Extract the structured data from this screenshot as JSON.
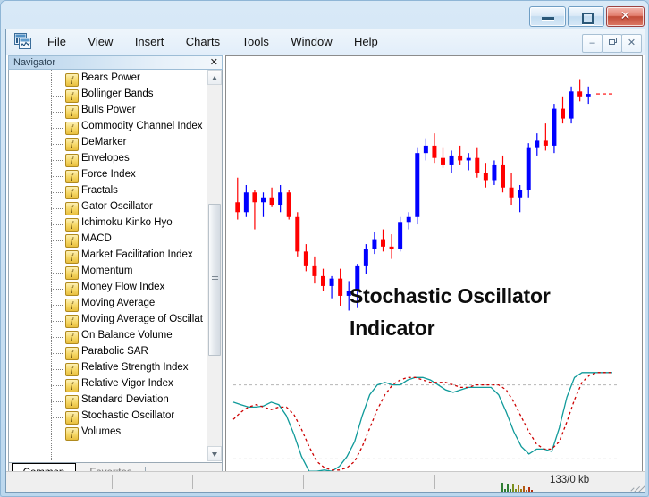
{
  "window": {
    "title": "",
    "controls": {
      "minimize": "minimize",
      "maximize": "maximize",
      "close": "✕"
    }
  },
  "menubar": {
    "app_icon": "charts-icon",
    "items": [
      {
        "label": "File"
      },
      {
        "label": "View"
      },
      {
        "label": "Insert"
      },
      {
        "label": "Charts"
      },
      {
        "label": "Tools"
      },
      {
        "label": "Window"
      },
      {
        "label": "Help"
      }
    ],
    "mdi_controls": {
      "minimize": "–",
      "restore": "❐",
      "close": "✕"
    }
  },
  "navigator": {
    "title": "Navigator",
    "close_label": "✕",
    "icon_glyph": "f",
    "items": [
      {
        "label": "Bears Power"
      },
      {
        "label": "Bollinger Bands"
      },
      {
        "label": "Bulls Power"
      },
      {
        "label": "Commodity Channel Index"
      },
      {
        "label": "DeMarker"
      },
      {
        "label": "Envelopes"
      },
      {
        "label": "Force Index"
      },
      {
        "label": "Fractals"
      },
      {
        "label": "Gator Oscillator"
      },
      {
        "label": "Ichimoku Kinko Hyo"
      },
      {
        "label": "MACD"
      },
      {
        "label": "Market Facilitation Index"
      },
      {
        "label": "Momentum"
      },
      {
        "label": "Money Flow Index"
      },
      {
        "label": "Moving Average"
      },
      {
        "label": "Moving Average of Oscillat"
      },
      {
        "label": "On Balance Volume"
      },
      {
        "label": "Parabolic SAR"
      },
      {
        "label": "Relative Strength Index"
      },
      {
        "label": "Relative Vigor Index"
      },
      {
        "label": "Standard Deviation"
      },
      {
        "label": "Stochastic Oscillator"
      },
      {
        "label": "Volumes"
      }
    ],
    "tabs": [
      {
        "label": "Common",
        "active": true
      },
      {
        "label": "Favorites",
        "active": false
      }
    ]
  },
  "chart": {
    "caption_line1": "Stochastic Oscillator",
    "caption_line2": "Indicator",
    "colors": {
      "bull": "#0000ff",
      "bear": "#ff0000",
      "k_line": "#109a9a",
      "d_line": "#cc0000",
      "level_line": "#b5b5b5"
    }
  },
  "statusbar": {
    "panes": [
      "",
      "",
      "",
      ""
    ],
    "traffic": "133/0 kb",
    "signal_icon": "signal-bars-icon"
  },
  "chart_data": {
    "type": "line",
    "title": "Stochastic Oscillator Indicator",
    "xlabel": "",
    "ylabel": "",
    "panes": [
      {
        "name": "price",
        "type": "candlestick",
        "ylim": [
          0,
          100
        ],
        "candles": [
          {
            "o": 56,
            "h": 66,
            "l": 49,
            "c": 52
          },
          {
            "o": 52,
            "h": 63,
            "l": 50,
            "c": 60
          },
          {
            "o": 60,
            "h": 61,
            "l": 45,
            "c": 56
          },
          {
            "o": 56,
            "h": 60,
            "l": 50,
            "c": 58
          },
          {
            "o": 58,
            "h": 62,
            "l": 54,
            "c": 55
          },
          {
            "o": 55,
            "h": 63,
            "l": 52,
            "c": 60
          },
          {
            "o": 60,
            "h": 61,
            "l": 49,
            "c": 50
          },
          {
            "o": 50,
            "h": 52,
            "l": 34,
            "c": 36
          },
          {
            "o": 36,
            "h": 39,
            "l": 28,
            "c": 30
          },
          {
            "o": 30,
            "h": 34,
            "l": 23,
            "c": 26
          },
          {
            "o": 26,
            "h": 29,
            "l": 20,
            "c": 22
          },
          {
            "o": 22,
            "h": 26,
            "l": 17,
            "c": 25
          },
          {
            "o": 25,
            "h": 29,
            "l": 14,
            "c": 18
          },
          {
            "o": 18,
            "h": 24,
            "l": 12,
            "c": 20
          },
          {
            "o": 20,
            "h": 31,
            "l": 13,
            "c": 30
          },
          {
            "o": 30,
            "h": 39,
            "l": 27,
            "c": 37
          },
          {
            "o": 37,
            "h": 44,
            "l": 35,
            "c": 41
          },
          {
            "o": 41,
            "h": 45,
            "l": 36,
            "c": 38
          },
          {
            "o": 38,
            "h": 43,
            "l": 33,
            "c": 37
          },
          {
            "o": 37,
            "h": 50,
            "l": 36,
            "c": 48
          },
          {
            "o": 48,
            "h": 52,
            "l": 45,
            "c": 50
          },
          {
            "o": 50,
            "h": 78,
            "l": 47,
            "c": 76
          },
          {
            "o": 76,
            "h": 82,
            "l": 73,
            "c": 79
          },
          {
            "o": 79,
            "h": 84,
            "l": 72,
            "c": 74
          },
          {
            "o": 74,
            "h": 78,
            "l": 70,
            "c": 71
          },
          {
            "o": 71,
            "h": 77,
            "l": 68,
            "c": 75
          },
          {
            "o": 75,
            "h": 79,
            "l": 71,
            "c": 73
          },
          {
            "o": 73,
            "h": 76,
            "l": 69,
            "c": 74
          },
          {
            "o": 74,
            "h": 78,
            "l": 66,
            "c": 68
          },
          {
            "o": 68,
            "h": 72,
            "l": 62,
            "c": 65
          },
          {
            "o": 65,
            "h": 73,
            "l": 63,
            "c": 71
          },
          {
            "o": 71,
            "h": 75,
            "l": 60,
            "c": 62
          },
          {
            "o": 62,
            "h": 68,
            "l": 55,
            "c": 58
          },
          {
            "o": 58,
            "h": 63,
            "l": 52,
            "c": 61
          },
          {
            "o": 61,
            "h": 80,
            "l": 58,
            "c": 78
          },
          {
            "o": 78,
            "h": 84,
            "l": 75,
            "c": 81
          },
          {
            "o": 81,
            "h": 88,
            "l": 77,
            "c": 79
          },
          {
            "o": 79,
            "h": 96,
            "l": 76,
            "c": 94
          },
          {
            "o": 94,
            "h": 99,
            "l": 88,
            "c": 90
          },
          {
            "o": 90,
            "h": 103,
            "l": 88,
            "c": 101
          },
          {
            "o": 101,
            "h": 106,
            "l": 97,
            "c": 99
          },
          {
            "o": 99,
            "h": 103,
            "l": 96,
            "c": 100
          }
        ]
      },
      {
        "name": "stochastic",
        "type": "line",
        "ylim": [
          0,
          100
        ],
        "levels": [
          80,
          20
        ],
        "series": [
          {
            "name": "%K",
            "style": "solid",
            "color": "#109a9a",
            "values": [
              66,
              64,
              62,
              62,
              63,
              66,
              64,
              55,
              40,
              22,
              10,
              10,
              11,
              10,
              14,
              22,
              34,
              55,
              72,
              80,
              82,
              80,
              80,
              84,
              86,
              86,
              84,
              80,
              76,
              74,
              76,
              78,
              78,
              78,
              78,
              72,
              58,
              42,
              30,
              24,
              28,
              28,
              26,
              45,
              70,
              86,
              90,
              90,
              90,
              90,
              90
            ]
          },
          {
            "name": "%D",
            "style": "dashed",
            "color": "#cc0000",
            "values": [
              52,
              58,
              62,
              64,
              62,
              60,
              62,
              62,
              56,
              44,
              30,
              18,
              13,
              11,
              11,
              13,
              18,
              30,
              45,
              60,
              72,
              80,
              84,
              86,
              86,
              84,
              82,
              82,
              82,
              80,
              78,
              78,
              80,
              80,
              80,
              80,
              76,
              66,
              54,
              42,
              32,
              28,
              28,
              34,
              50,
              68,
              82,
              88,
              90,
              90,
              90
            ]
          }
        ]
      }
    ]
  }
}
